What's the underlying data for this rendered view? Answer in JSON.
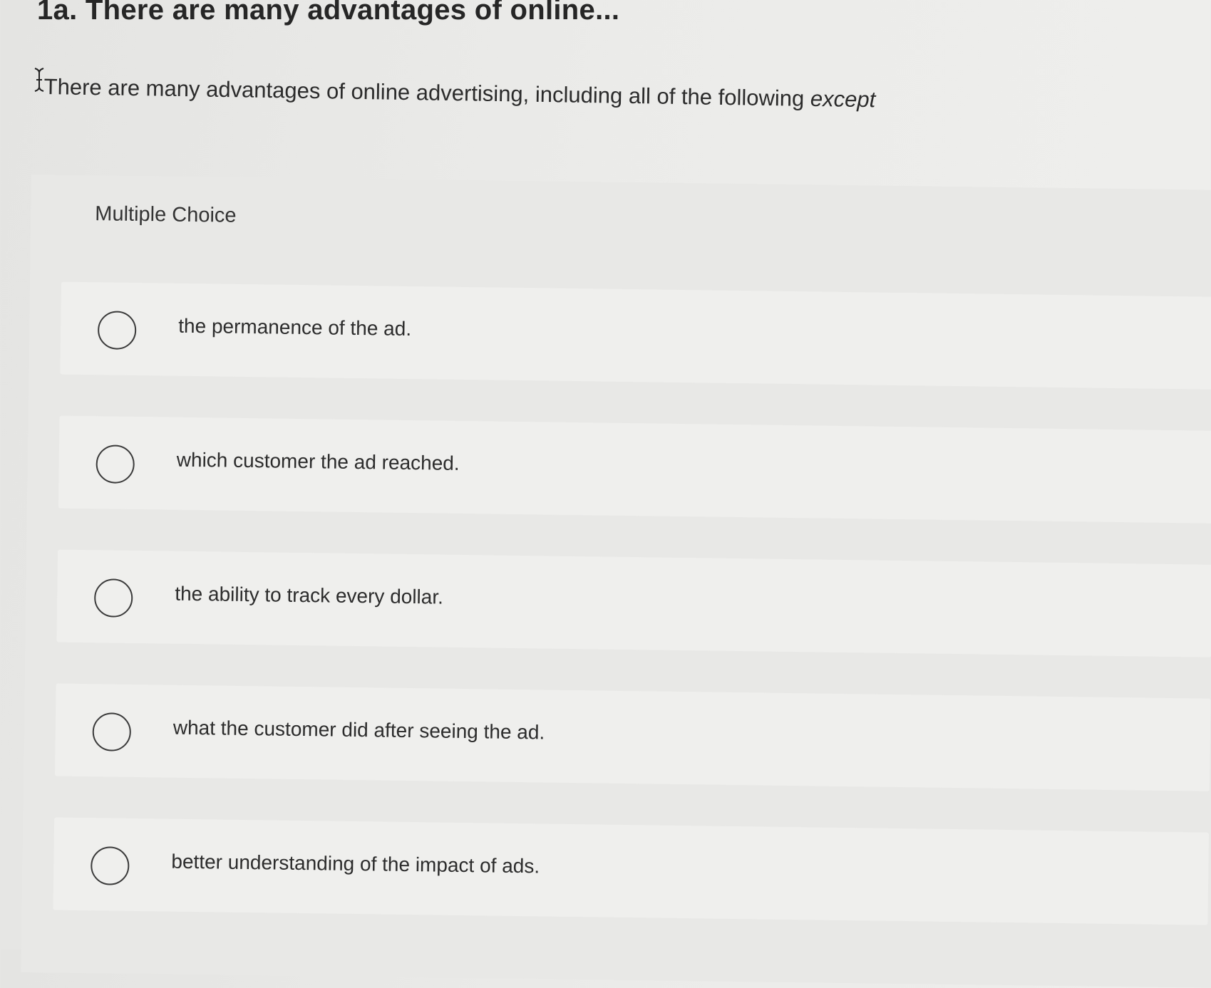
{
  "question": {
    "title": "1a. There are many advantages of online...",
    "text": "There are many advantages of online advertising, including all of the following",
    "emphasis": "except"
  },
  "multiple_choice": {
    "header": "Multiple Choice",
    "options": [
      {
        "label": "the permanence of the ad.",
        "selected": false
      },
      {
        "label": "which customer the ad reached.",
        "selected": false
      },
      {
        "label": "the ability to track every dollar.",
        "selected": false
      },
      {
        "label": "what the customer did after seeing the ad.",
        "selected": false
      },
      {
        "label": "better understanding of the impact of ads.",
        "selected": false
      }
    ]
  },
  "icons": {
    "cursor": "text-cursor-icon",
    "radio": "radio-button-icon"
  }
}
